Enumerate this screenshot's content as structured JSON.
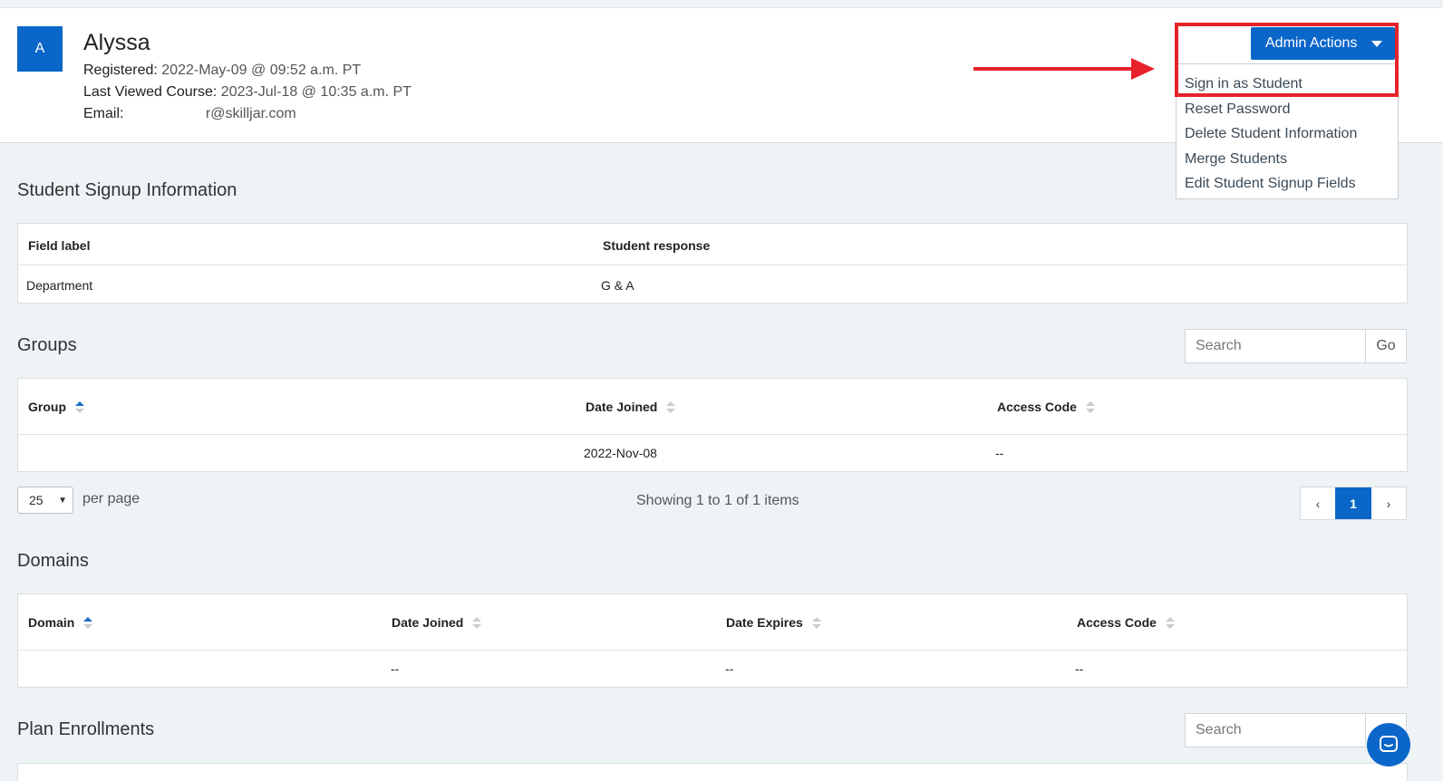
{
  "profile": {
    "avatar_initial": "A",
    "name": "Alyssa",
    "registered_label": "Registered:",
    "registered_value": "2022-May-09 @ 09:52 a.m. PT",
    "last_viewed_label": "Last Viewed Course:",
    "last_viewed_value": "2023-Jul-18 @ 10:35 a.m. PT",
    "email_label": "Email:",
    "email_value": "r@skilljar.com"
  },
  "admin_actions": {
    "button_label": "Admin Actions",
    "items": [
      "Sign in as Student",
      "Reset Password",
      "Delete Student Information",
      "Merge Students",
      "Edit Student Signup Fields"
    ]
  },
  "signup_info": {
    "title": "Student Signup Information",
    "columns": [
      "Field label",
      "Student response"
    ],
    "rows": [
      [
        "Department",
        "G & A"
      ]
    ]
  },
  "groups": {
    "title": "Groups",
    "search_placeholder": "Search",
    "go_label": "Go",
    "columns": [
      "Group",
      "Date Joined",
      "Access Code"
    ],
    "rows": [
      [
        "",
        "2022-Nov-08",
        "--"
      ]
    ],
    "per_page_value": "25",
    "per_page_label": "per page",
    "showing_text": "Showing 1 to 1 of 1 items",
    "pager": {
      "prev": "‹",
      "current": "1",
      "next": "›"
    }
  },
  "domains": {
    "title": "Domains",
    "columns": [
      "Domain",
      "Date Joined",
      "Date Expires",
      "Access Code"
    ],
    "rows": [
      [
        "",
        "--",
        "--",
        "--"
      ]
    ]
  },
  "plan_enrollments": {
    "title": "Plan Enrollments",
    "search_placeholder": "Search"
  },
  "colors": {
    "primary": "#0b66c9",
    "highlight_red": "#e6222a",
    "page_bg": "#eef3f6"
  }
}
